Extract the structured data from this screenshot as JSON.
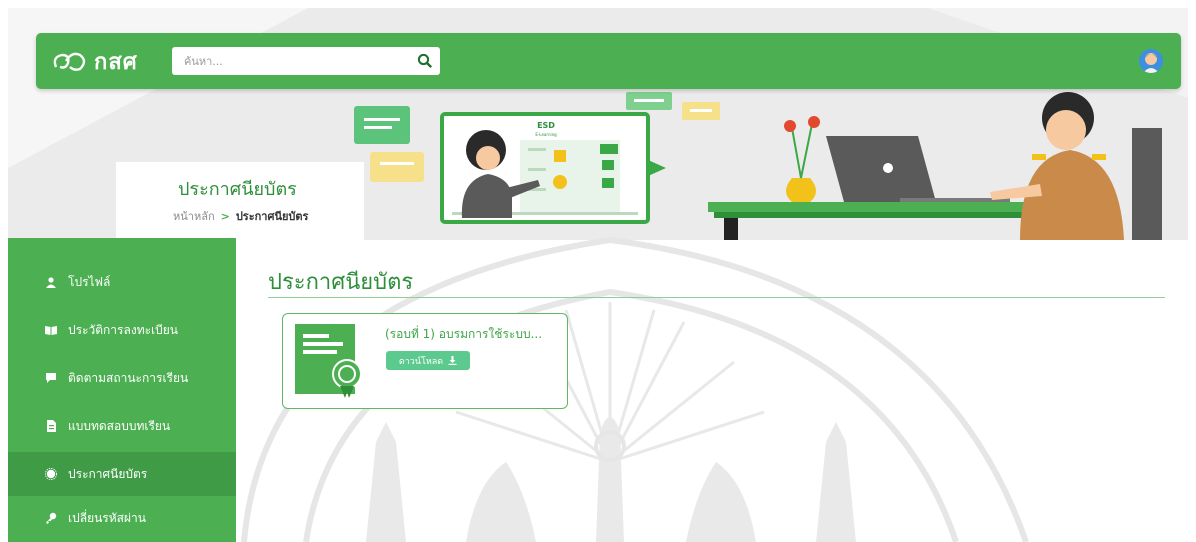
{
  "header": {
    "logo_text": "กสศ",
    "search_placeholder": "ค้นหา..."
  },
  "banner": {
    "page_title": "ประกาศนียบัตร",
    "breadcrumb": {
      "home": "หน้าหลัก",
      "separator": ">",
      "current": "ประกาศนียบัตร"
    },
    "screen_title": "ESD",
    "screen_subtitle": "E-Learning"
  },
  "sidebar": {
    "items": [
      {
        "label": "โปรไฟล์",
        "icon": "user-icon"
      },
      {
        "label": "ประวัติการลงทะเบียน",
        "icon": "book-icon"
      },
      {
        "label": "ติดตามสถานะการเรียน",
        "icon": "chat-icon"
      },
      {
        "label": "แบบทดสอบบทเรียน",
        "icon": "document-icon"
      },
      {
        "label": "ประกาศนียบัตร",
        "icon": "certificate-icon",
        "active": true
      },
      {
        "label": "เปลี่ยนรหัสผ่าน",
        "icon": "key-icon"
      }
    ]
  },
  "main": {
    "title": "ประกาศนียบัตร",
    "certificates": [
      {
        "title": "(รอบที่ 1) อบรมการใช้ระบบ...",
        "download_label": "ดาวน์โหลด"
      }
    ]
  },
  "colors": {
    "primary_green": "#4cb052",
    "active_green": "#3f9b46",
    "title_green": "#2e8f3a",
    "button_green": "#5cc98e"
  }
}
